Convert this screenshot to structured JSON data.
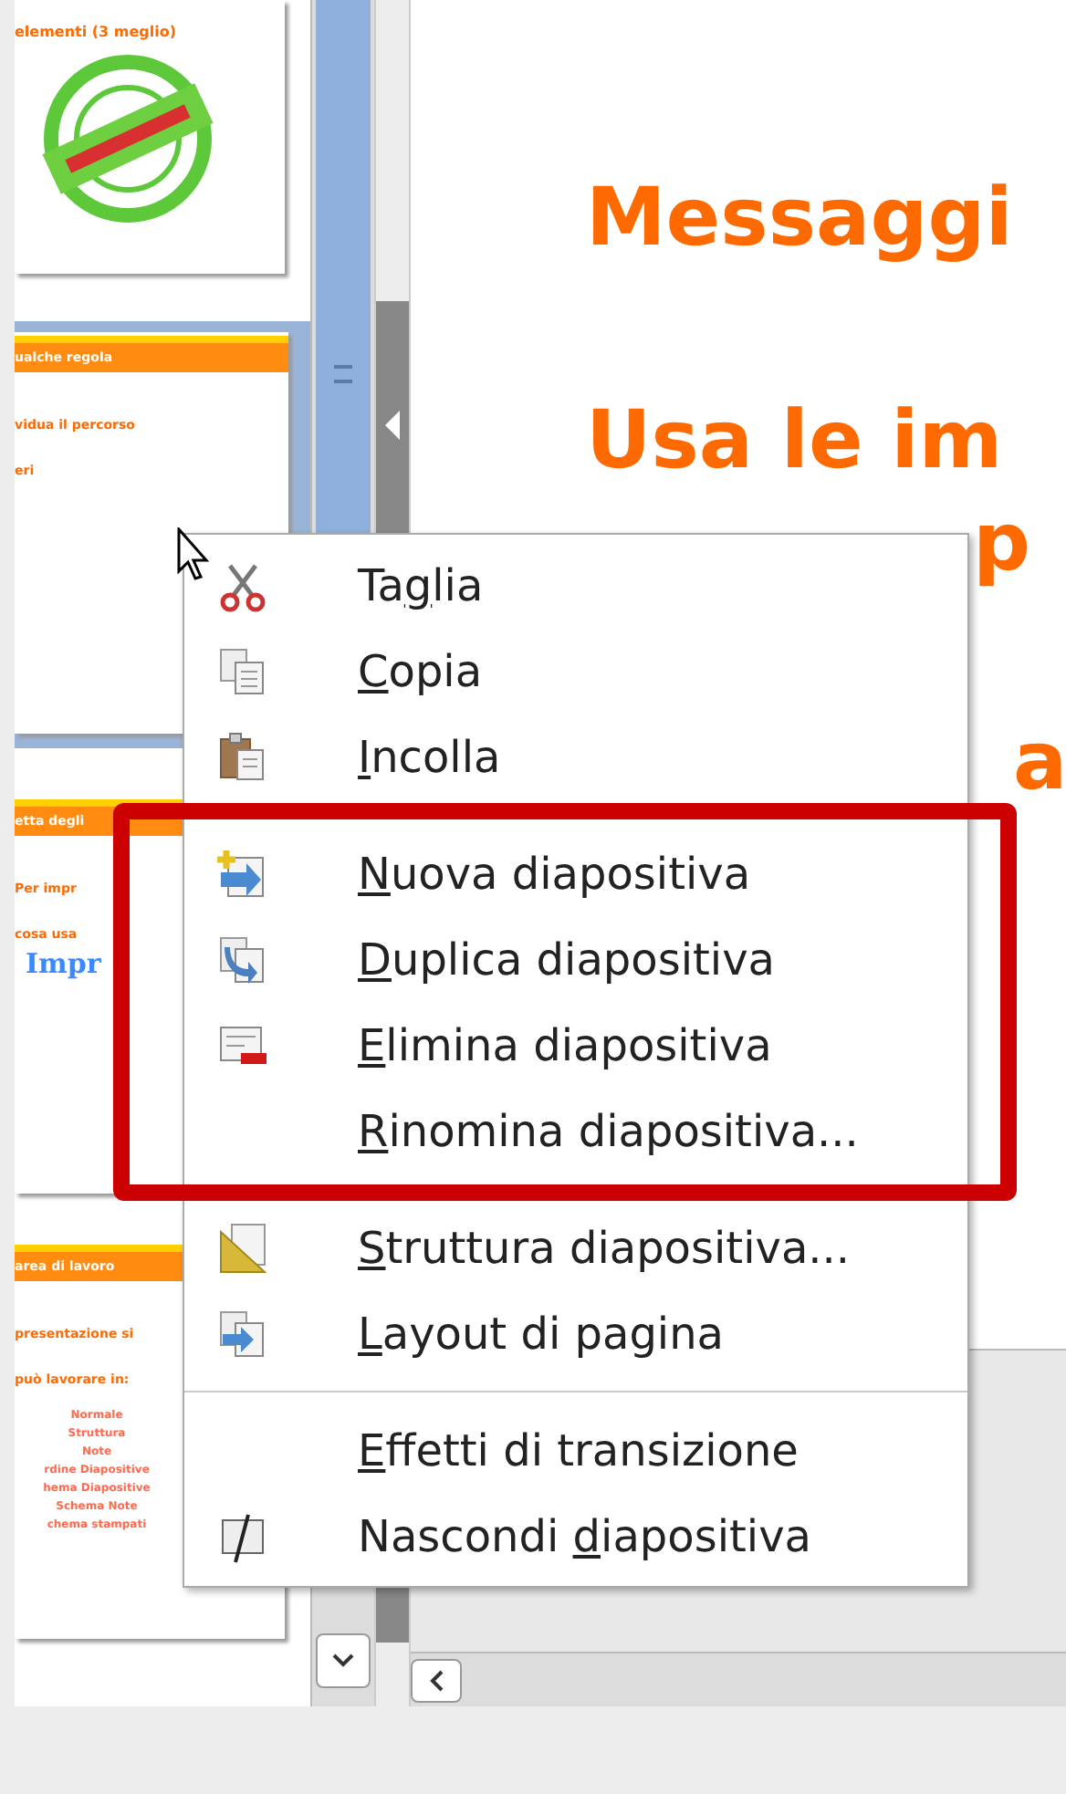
{
  "slides_panel": {
    "slides": [
      {
        "selected": false,
        "lines": [
          "elementi (3 meglio)"
        ],
        "kind": "stamp"
      },
      {
        "selected": true,
        "header": "ualche regola",
        "lines": [
          "vidua il percorso",
          "eri"
        ],
        "kind": "text"
      },
      {
        "selected": false,
        "header": "etta degli",
        "lines": [
          "Per impr",
          "cosa usa"
        ],
        "big": "Impr",
        "kind": "text"
      },
      {
        "selected": false,
        "header": "area di lavoro",
        "lines": [
          "presentazione si",
          "può lavorare in:"
        ],
        "center_lines": [
          "Normale",
          "Struttura",
          "Note",
          "rdine Diapositive",
          "hema Diapositive",
          "Schema Note",
          "chema stampati"
        ],
        "kind": "text"
      }
    ]
  },
  "slide": {
    "lines": [
      "Messaggi",
      "Usa le im"
    ],
    "fragments": [
      "p",
      "a"
    ]
  },
  "context_menu": {
    "items": [
      {
        "pre": "Ta",
        "key": "g",
        "post": "lia",
        "separator_before": false
      },
      {
        "key": "C",
        "post": "opia",
        "separator_before": false
      },
      {
        "key": "I",
        "post": "ncolla",
        "separator_before": false
      },
      {
        "key": "N",
        "post": "uova diapositiva",
        "separator_before": true
      },
      {
        "key": "D",
        "post": "uplica diapositiva",
        "separator_before": false
      },
      {
        "key": "E",
        "post": "limina diapositiva",
        "separator_before": false
      },
      {
        "key": "R",
        "post": "inomina diapositiva...",
        "separator_before": false
      },
      {
        "key": "S",
        "post": "truttura diapositiva...",
        "separator_before": true
      },
      {
        "key": "L",
        "post": "ayout di pagina",
        "separator_before": false
      },
      {
        "key": "E",
        "post": "ffetti di transizione",
        "separator_before": true
      },
      {
        "pre": "Nascondi ",
        "key": "d",
        "post": "iapositiva",
        "separator_before": false
      }
    ]
  }
}
